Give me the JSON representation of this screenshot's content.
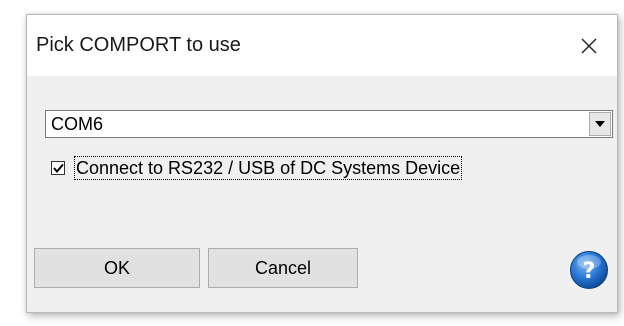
{
  "dialog": {
    "title": "Pick COMPORT to use",
    "close_icon": "close-icon"
  },
  "port_select": {
    "value": "COM6",
    "dropdown_icon": "chevron-down-icon"
  },
  "connect_option": {
    "checked": true,
    "label": "Connect to RS232 / USB of DC Systems Device"
  },
  "buttons": {
    "ok_label": "OK",
    "cancel_label": "Cancel",
    "help_icon": "help-icon"
  },
  "colors": {
    "help_blue": "#1e6ec8",
    "title_bar": "#ffffff",
    "dialog_body": "#f0f0f0"
  }
}
